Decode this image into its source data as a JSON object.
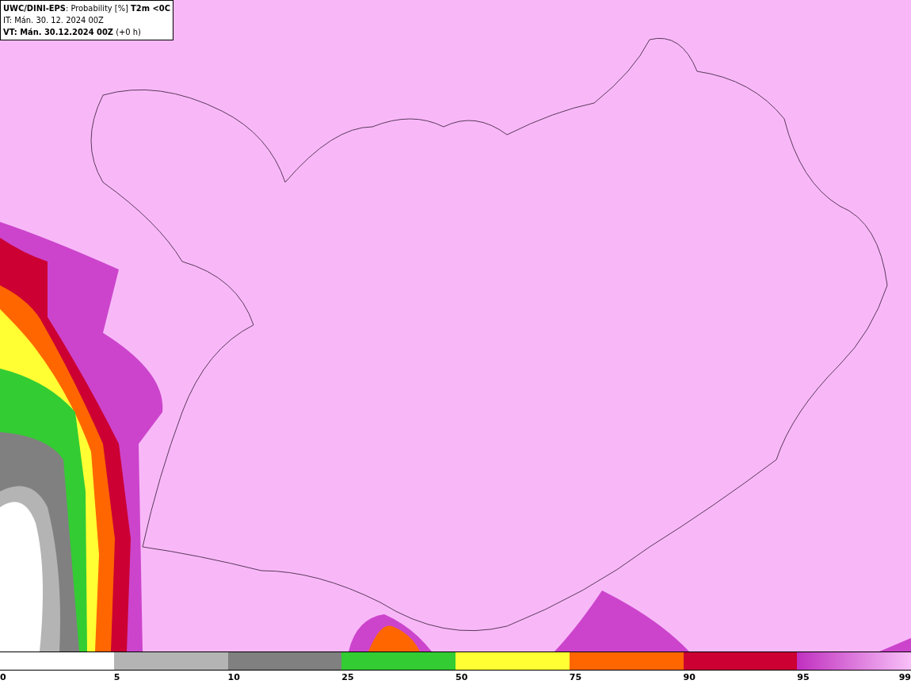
{
  "header": {
    "title": "**UWC/DINI-EPS**: Probability [%] **T2m <0C**",
    "init_time": "IT: Mán. 30. 12. 2024 00Z",
    "valid_time": "**VT: Mán. 30.12.2024 00Z** (+0 h)"
  },
  "legend": {
    "segments": [
      {
        "label": "0",
        "color": "#ffffff"
      },
      {
        "label": "5",
        "color": "#b4b4b4"
      },
      {
        "label": "10",
        "color": "#808080"
      },
      {
        "label": "25",
        "color": "#33cc33"
      },
      {
        "label": "50",
        "color": "#ffff33"
      },
      {
        "label": "75",
        "color": "#ff6600"
      },
      {
        "label": "90",
        "color": "#cc0033"
      },
      {
        "label": "95",
        "color": "#c030c0"
      }
    ],
    "end_label": "99"
  }
}
